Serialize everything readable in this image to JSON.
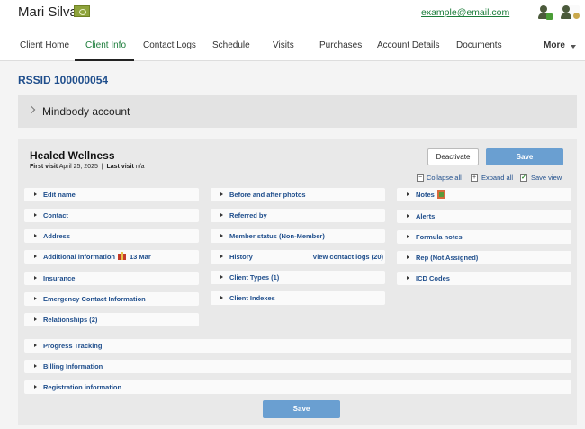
{
  "client": {
    "name": "Mari Silva",
    "email": "example@email.com"
  },
  "header_icons": [
    "add-person-icon",
    "person-badge-icon"
  ],
  "tabs": [
    {
      "label": "Client Home",
      "active": false
    },
    {
      "label": "Client Info",
      "active": true
    },
    {
      "label": "Contact Logs",
      "active": false
    },
    {
      "label": "Schedule",
      "active": false
    },
    {
      "label": "Visits",
      "active": false
    },
    {
      "label": "Purchases",
      "active": false
    },
    {
      "label": "Account Details",
      "active": false
    },
    {
      "label": "Documents",
      "active": false
    },
    {
      "label": "More",
      "active": false
    }
  ],
  "rssid": "RSSID 100000054",
  "account_section": {
    "title": "Mindbody account"
  },
  "business": {
    "name": "Healed Wellness",
    "first_visit_label": "First visit",
    "first_visit_date": "April 25, 2025",
    "last_visit_label": "Last visit",
    "last_visit_value": "n/a"
  },
  "actions": {
    "deactivate": "Deactivate",
    "save": "Save",
    "collapse_all": "Collapse all",
    "expand_all": "Expand all",
    "save_view": "Save view"
  },
  "sections": {
    "col1": [
      "Edit name",
      "Contact",
      "Address",
      "Additional information",
      "Insurance",
      "Emergency Contact Information",
      "Relationships (2)"
    ],
    "additional_info_date": "13 Mar",
    "col2": [
      "Before and after photos",
      "Referred by",
      "Member status (Non-Member)",
      "History",
      "Client Types (1)",
      "Client Indexes"
    ],
    "history_link": "View contact logs (20)",
    "col3": [
      "Notes",
      "Alerts",
      "Formula notes",
      "Rep (Not Assigned)",
      "ICD Codes"
    ],
    "full": [
      "Progress Tracking",
      "Billing Information",
      "Registration information"
    ]
  },
  "colors": {
    "accent_green": "#1b7c3a",
    "link_blue": "#1f4e8c",
    "save_button": "#6a9fd1"
  }
}
